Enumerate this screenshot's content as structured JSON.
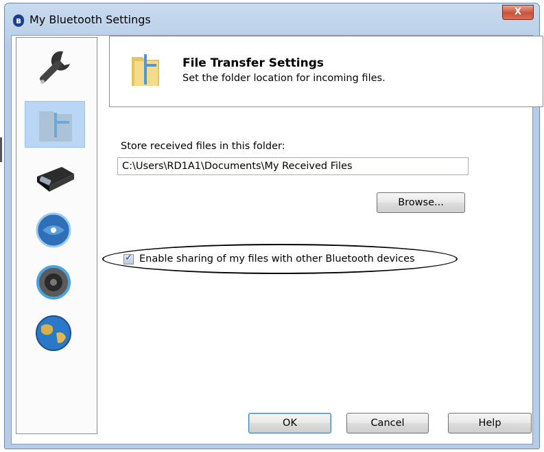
{
  "window": {
    "title": "My Bluetooth Settings",
    "close_label": "X",
    "app_icon": "bluetooth-icon"
  },
  "sidebar": {
    "items": [
      {
        "icon": "wrench-icon"
      },
      {
        "icon": "folder-transfer-icon",
        "selected": true
      },
      {
        "icon": "serial-port-icon"
      },
      {
        "icon": "network-globe-icon"
      },
      {
        "icon": "speaker-icon"
      },
      {
        "icon": "earth-globe-icon"
      }
    ]
  },
  "header": {
    "icon": "folder-icon",
    "title": "File Transfer Settings",
    "subtitle": "Set the folder location for incoming files."
  },
  "folder": {
    "label": "Store received files in this folder:",
    "path": "C:\\Users\\RD1A1\\Documents\\My Received Files",
    "browse_label": "Browse..."
  },
  "sharing": {
    "checked": true,
    "label": "Enable sharing of my files with other Bluetooth devices"
  },
  "buttons": {
    "ok": "OK",
    "cancel": "Cancel",
    "help": "Help"
  },
  "colors": {
    "selection": "#b9d6f5",
    "title_bar": "#bdd2ea",
    "close": "#c9513a"
  }
}
